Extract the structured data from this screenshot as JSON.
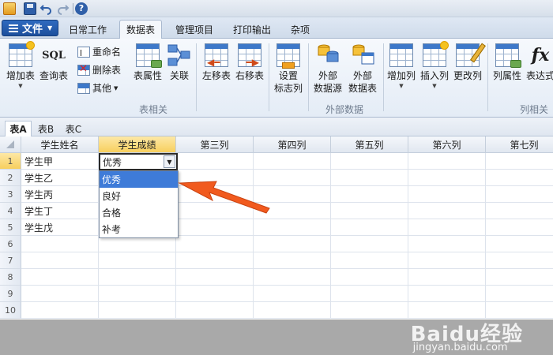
{
  "tabs": {
    "file": "文件",
    "items": [
      "日常工作",
      "数据表",
      "管理项目",
      "打印输出",
      "杂项"
    ],
    "active_index": 1
  },
  "ribbon": {
    "add_table": "增加表",
    "query_table": "查询表",
    "rename": "重命名",
    "delete_table": "删除表",
    "other": "其他",
    "table_props": "表属性",
    "relation": "关联",
    "move_left": "左移表",
    "move_right": "右移表",
    "set_flag_col": [
      "设置",
      "标志列"
    ],
    "ext_source": [
      "外部",
      "数据源"
    ],
    "ext_table": [
      "外部",
      "数据表"
    ],
    "add_col": "增加列",
    "insert_col": "插入列",
    "change_col": "更改列",
    "col_props": "列属性",
    "expression": "表达式",
    "group_table": "表相关",
    "group_external": "外部数据",
    "group_column": "列相关"
  },
  "sheet_tabs": [
    "表A",
    "表B",
    "表C"
  ],
  "active_sheet": 0,
  "grid": {
    "columns": [
      "学生姓名",
      "学生成绩",
      "第三列",
      "第四列",
      "第五列",
      "第六列",
      "第七列"
    ],
    "selected_column": 1,
    "row_numbers": [
      "1",
      "2",
      "3",
      "4",
      "5",
      "6",
      "7",
      "8",
      "9",
      "10"
    ],
    "selected_row": 0,
    "names": [
      "学生甲",
      "学生乙",
      "学生丙",
      "学生丁",
      "学生戊"
    ]
  },
  "editor": {
    "value": "优秀",
    "options": [
      "优秀",
      "良好",
      "合格",
      "补考"
    ],
    "highlighted_index": 0
  },
  "watermark": {
    "brand": "Baidu经验",
    "url": "jingyan.baidu.com"
  },
  "colors": {
    "accent": "#3e7bd8",
    "file_button": "#2f6bc0",
    "arrow": "#f15a1e"
  }
}
